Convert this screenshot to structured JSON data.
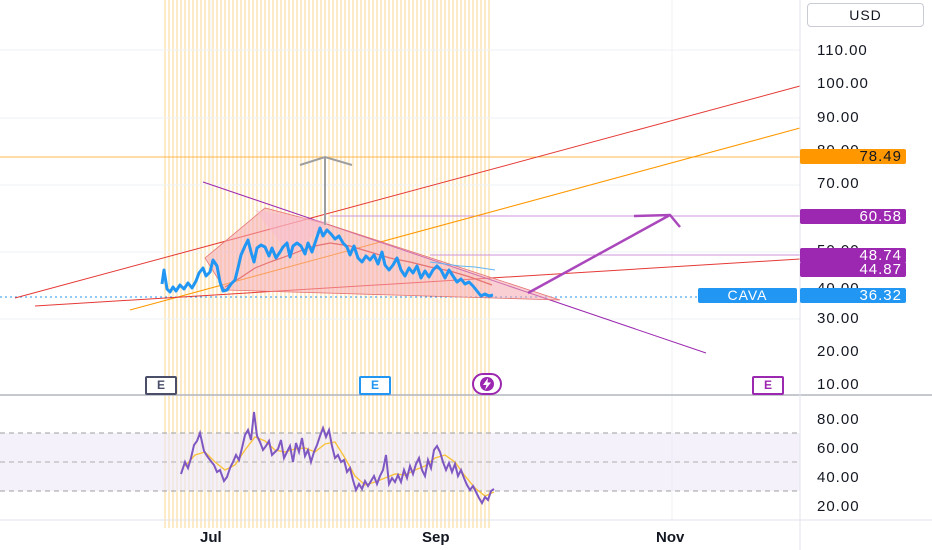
{
  "currency_selector": {
    "label": "USD"
  },
  "ticker": {
    "symbol": "CAVA",
    "last_price": "36.32"
  },
  "price_axis": {
    "ticks": [
      "110.00",
      "100.00",
      "90.00",
      "80.00",
      "70.00",
      "60.00",
      "50.00",
      "40.00",
      "30.00",
      "20.00",
      "10.00"
    ]
  },
  "price_tags": [
    {
      "value": "78.49",
      "bg": "#ff9800",
      "fg": "#131722"
    },
    {
      "value": "60.58",
      "bg": "#9c27b0",
      "fg": "#ffffff"
    },
    {
      "value": "48.74",
      "bg": "#9c27b0",
      "fg": "#ffffff"
    },
    {
      "value": "44.87",
      "bg": "#9c27b0",
      "fg": "#ffffff"
    }
  ],
  "oscillator_axis": {
    "ticks": [
      "80.00",
      "60.00",
      "40.00",
      "20.00"
    ]
  },
  "time_axis": {
    "ticks": [
      "Jul",
      "Sep",
      "Nov"
    ]
  },
  "events": {
    "earnings_label": "E",
    "dividend_icon": "lightning-icon"
  },
  "colors": {
    "price_line": "#2196f3",
    "oscillator": "#7e57c2",
    "oscillator_ma": "#f9c23c",
    "drawing_red": "#e53935",
    "drawing_orange": "#ff9800",
    "drawing_purple": "#9c27b0",
    "triangle_fill": "#f5a8ae"
  }
}
